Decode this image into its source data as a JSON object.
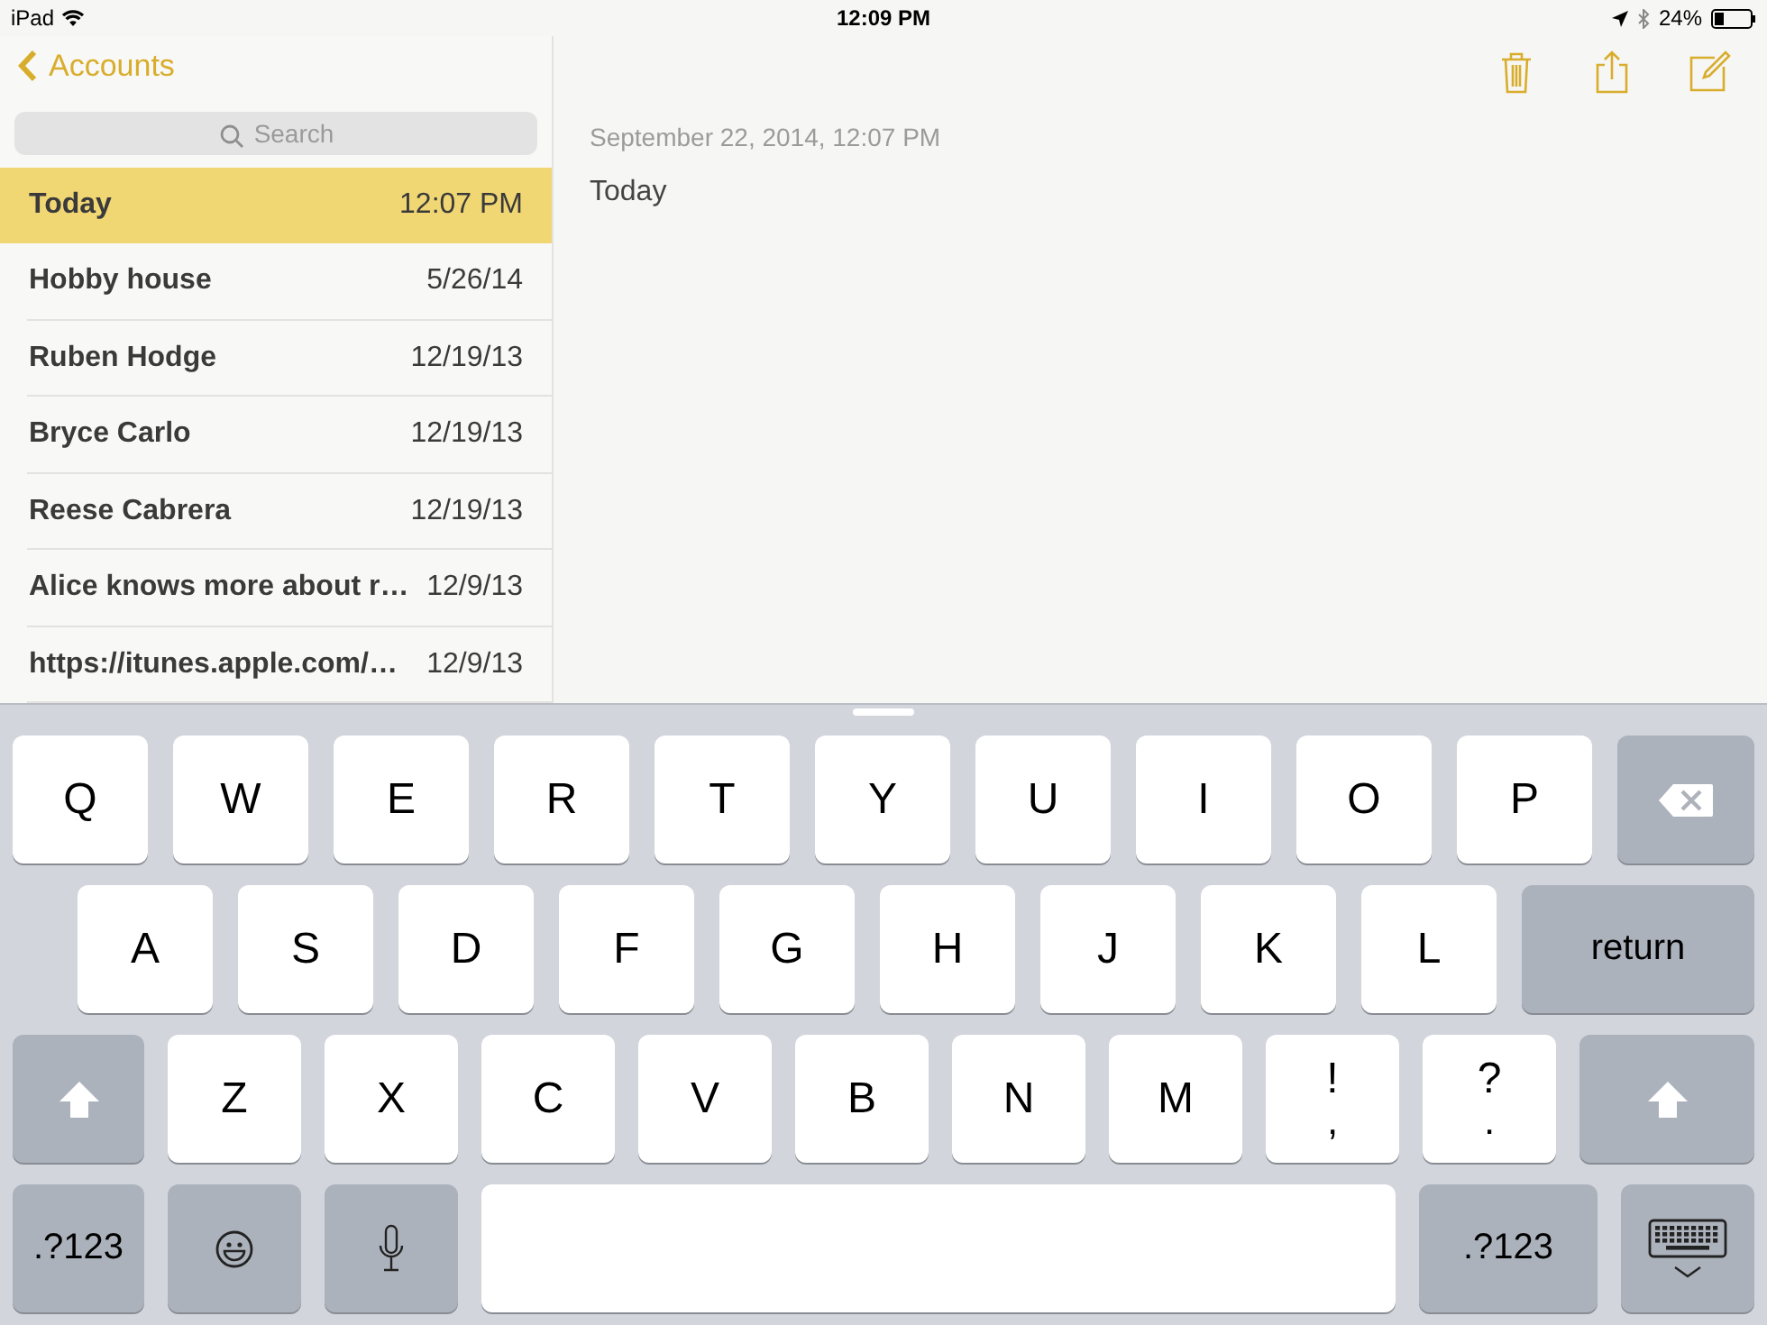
{
  "status_bar": {
    "device": "iPad",
    "time": "12:09 PM",
    "battery": "24%"
  },
  "sidebar": {
    "back_button": "Accounts",
    "search": {
      "placeholder": "Search"
    },
    "notes": [
      {
        "title": "Today",
        "date": "12:07 PM",
        "selected": true
      },
      {
        "title": "Hobby house",
        "date": "5/26/14",
        "selected": false
      },
      {
        "title": "Ruben Hodge",
        "date": "12/19/13",
        "selected": false
      },
      {
        "title": "Bryce Carlo",
        "date": "12/19/13",
        "selected": false
      },
      {
        "title": "Reese Cabrera",
        "date": "12/19/13",
        "selected": false
      },
      {
        "title": "Alice knows more about r…",
        "date": "12/9/13",
        "selected": false
      },
      {
        "title": "https://itunes.apple.com/…",
        "date": "12/9/13",
        "selected": false
      }
    ]
  },
  "note": {
    "timestamp": "September 22, 2014, 12:07 PM",
    "body": "Today"
  },
  "keyboard": {
    "rows": [
      {
        "keys": [
          {
            "kind": "letter",
            "label": "Q"
          },
          {
            "kind": "letter",
            "label": "W"
          },
          {
            "kind": "letter",
            "label": "E"
          },
          {
            "kind": "letter",
            "label": "R"
          },
          {
            "kind": "letter",
            "label": "T"
          },
          {
            "kind": "letter",
            "label": "Y"
          },
          {
            "kind": "letter",
            "label": "U"
          },
          {
            "kind": "letter",
            "label": "I"
          },
          {
            "kind": "letter",
            "label": "O"
          },
          {
            "kind": "letter",
            "label": "P"
          },
          {
            "kind": "delete"
          }
        ]
      },
      {
        "keys": [
          {
            "kind": "letter",
            "label": "A"
          },
          {
            "kind": "letter",
            "label": "S"
          },
          {
            "kind": "letter",
            "label": "D"
          },
          {
            "kind": "letter",
            "label": "F"
          },
          {
            "kind": "letter",
            "label": "G"
          },
          {
            "kind": "letter",
            "label": "H"
          },
          {
            "kind": "letter",
            "label": "J"
          },
          {
            "kind": "letter",
            "label": "K"
          },
          {
            "kind": "letter",
            "label": "L"
          },
          {
            "kind": "function",
            "label": "return"
          }
        ]
      },
      {
        "keys": [
          {
            "kind": "shift"
          },
          {
            "kind": "letter",
            "label": "Z"
          },
          {
            "kind": "letter",
            "label": "X"
          },
          {
            "kind": "letter",
            "label": "C"
          },
          {
            "kind": "letter",
            "label": "V"
          },
          {
            "kind": "letter",
            "label": "B"
          },
          {
            "kind": "letter",
            "label": "N"
          },
          {
            "kind": "letter",
            "label": "M"
          },
          {
            "kind": "letter",
            "label": "!",
            "sub": ","
          },
          {
            "kind": "letter",
            "label": "?",
            "sub": "."
          },
          {
            "kind": "shift"
          }
        ]
      },
      {
        "keys": [
          {
            "kind": "function",
            "label": ".?123"
          },
          {
            "kind": "emoji"
          },
          {
            "kind": "mic"
          },
          {
            "kind": "space"
          },
          {
            "kind": "function",
            "label": ".?123"
          },
          {
            "kind": "dismiss"
          }
        ]
      }
    ]
  }
}
